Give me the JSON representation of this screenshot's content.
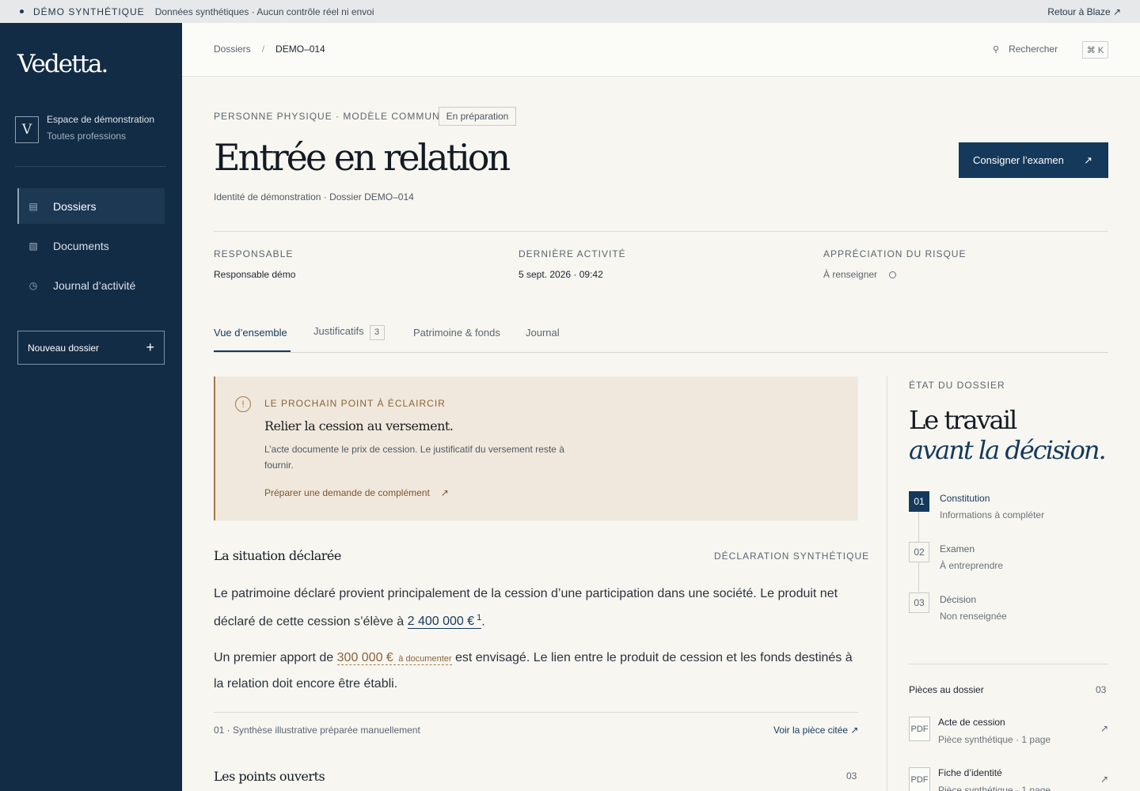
{
  "banner": {
    "tag": "DÉMO SYNTHÉTIQUE",
    "message": "Données synthétiques · Aucun contrôle réel ni envoi",
    "back_link": "Retour à Blaze ↗"
  },
  "sidebar": {
    "logo": "Vedetta.",
    "workspace": {
      "initial": "V",
      "name": "Espace de démonstration",
      "sub": "Toutes professions"
    },
    "items": [
      {
        "label": "Dossiers",
        "icon": "folder-list-icon",
        "active": true
      },
      {
        "label": "Documents",
        "icon": "documents-icon",
        "active": false
      },
      {
        "label": "Journal d’activité",
        "icon": "clock-icon",
        "active": false
      }
    ],
    "new_button": "Nouveau dossier"
  },
  "topbar": {
    "breadcrumb": {
      "root": "Dossiers",
      "separator": "/",
      "current": "DEMO–014"
    },
    "search_label": "Rechercher",
    "shortcut": "⌘ K"
  },
  "header": {
    "kicker": "PERSONNE PHYSIQUE · MODÈLE COMMUN",
    "status": "En préparation",
    "title": "Entrée en relation",
    "subtitle": "Identité de démonstration · Dossier DEMO–014",
    "primary_action": "Consigner l’examen"
  },
  "meta": {
    "responsable": {
      "label": "RESPONSABLE",
      "value": "Responsable démo"
    },
    "activity": {
      "label": "DERNIÈRE ACTIVITÉ",
      "value": "5 sept. 2026 · 09:42"
    },
    "risk": {
      "label": "APPRÉCIATION DU RISQUE",
      "value": "À renseigner"
    }
  },
  "tabs": [
    {
      "label": "Vue d’ensemble",
      "active": true
    },
    {
      "label": "Justificatifs",
      "count": "3"
    },
    {
      "label": "Patrimoine & fonds"
    },
    {
      "label": "Journal"
    }
  ],
  "alert": {
    "kicker": "LE PROCHAIN POINT À ÉCLAIRCIR",
    "title": "Relier la cession au versement.",
    "description": "L’acte documente le prix de cession. Le justificatif du versement reste à fournir.",
    "link": "Préparer une demande de complément"
  },
  "situation": {
    "title": "La situation déclarée",
    "right_label": "DÉCLARATION SYNTHÉTIQUE",
    "p1_before": "Le patrimoine déclaré provient principalement de la cession d’une participation dans une société. Le produit net déclaré de cette cession s’élève à ",
    "p1_amount": "2 400 000 €",
    "p1_note": "1",
    "p1_after": ".",
    "p2_before": "Un premier apport de ",
    "p2_amount": "300 000 €",
    "p2_tag": "à documenter",
    "p2_after": " est envisagé. Le lien entre le produit de cession et les fonds destinés à la relation doit encore être établi.",
    "footnote": "01 · Synthèse illustrative préparée manuellement",
    "cite_link": "Voir la pièce citée ↗"
  },
  "open_points": {
    "title": "Les points ouverts",
    "count": "03"
  },
  "status_panel": {
    "kicker": "ÉTAT DU DOSSIER",
    "title_line1": "Le travail",
    "title_line2": "avant la décision.",
    "steps": [
      {
        "num": "01",
        "title": "Constitution",
        "sub": "Informations à compléter",
        "active": true
      },
      {
        "num": "02",
        "title": "Examen",
        "sub": "À entreprendre",
        "active": false
      },
      {
        "num": "03",
        "title": "Décision",
        "sub": "Non renseignée",
        "active": false
      }
    ],
    "pieces_title": "Pièces au dossier",
    "pieces_count": "03",
    "pieces": [
      {
        "type": "PDF",
        "name": "Acte de cession",
        "meta": "Pièce synthétique · 1 page"
      },
      {
        "type": "PDF",
        "name": "Fiche d’identité",
        "meta": "Pièce synthétique · 1 page"
      }
    ]
  },
  "colors": {
    "navy": "#132c45",
    "accent": "#15395b",
    "alert_bg": "#f0e8dc",
    "alert_accent": "#a57a45"
  }
}
